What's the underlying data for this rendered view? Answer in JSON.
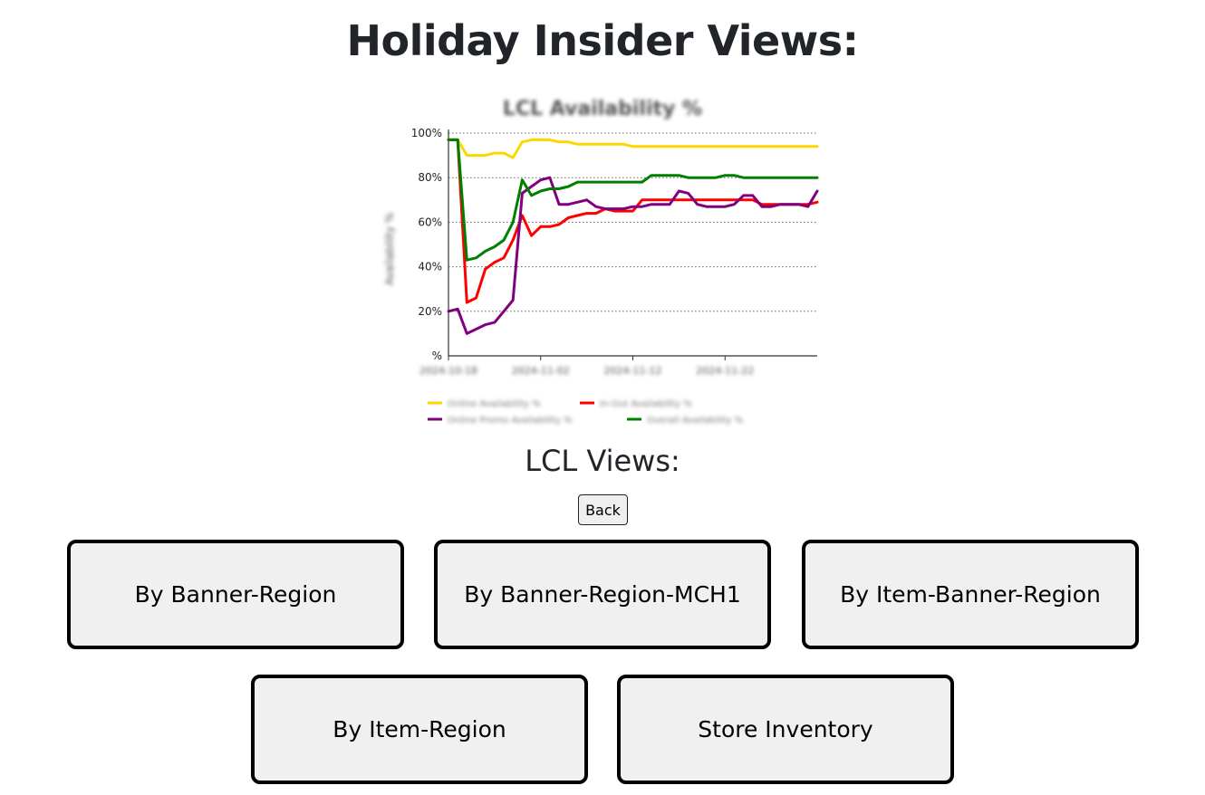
{
  "page": {
    "title": "Holiday Insider Views:",
    "section_title": "LCL Views:",
    "back_label": "Back"
  },
  "views": [
    {
      "label": "By Banner-Region"
    },
    {
      "label": "By Banner-Region-MCH1"
    },
    {
      "label": "By Item-Banner-Region"
    },
    {
      "label": "By Item-Region"
    },
    {
      "label": "Store Inventory"
    }
  ],
  "chart_data": {
    "type": "line",
    "title": "LCL Availability %",
    "ylabel": "Availability %",
    "ytick_labels": [
      "%",
      "20%",
      "40%",
      "60%",
      "80%",
      "100%"
    ],
    "ylim": [
      0,
      100
    ],
    "xtick_labels": [
      "2024-10-18",
      "2024-11-02",
      "2024-11-12",
      "2024-11-22"
    ],
    "x_index_range": [
      0,
      40
    ],
    "xtick_indices": [
      0,
      10,
      20,
      30
    ],
    "grid": "horizontal dotted",
    "legend_position": "bottom",
    "series": [
      {
        "name": "Online Availability %",
        "color": "#FFD700",
        "values": [
          97,
          97,
          90,
          90,
          90,
          91,
          91,
          89,
          96,
          97,
          97,
          97,
          96,
          96,
          95,
          95,
          95,
          95,
          95,
          95,
          94,
          94,
          94,
          94,
          94,
          94,
          94,
          94,
          94,
          94,
          94,
          94,
          94,
          94,
          94,
          94,
          94,
          94,
          94,
          94,
          94
        ]
      },
      {
        "name": "In-Out Availability %",
        "color": "#FF0000",
        "values": [
          97,
          97,
          24,
          26,
          39,
          42,
          44,
          52,
          63,
          54,
          58,
          58,
          59,
          62,
          63,
          64,
          64,
          66,
          65,
          65,
          65,
          70,
          70,
          70,
          70,
          70,
          70,
          70,
          70,
          70,
          70,
          70,
          70,
          70,
          68,
          68,
          68,
          68,
          68,
          68,
          69
        ]
      },
      {
        "name": "Online Promo Availability %",
        "color": "#800080",
        "values": [
          20,
          21,
          10,
          12,
          14,
          15,
          20,
          25,
          73,
          76,
          79,
          80,
          68,
          68,
          69,
          70,
          67,
          66,
          66,
          66,
          67,
          67,
          68,
          68,
          68,
          74,
          73,
          68,
          67,
          67,
          67,
          68,
          72,
          72,
          67,
          67,
          68,
          68,
          68,
          67,
          74
        ]
      },
      {
        "name": "Overall Availability %",
        "color": "#008000",
        "values": [
          97,
          97,
          43,
          44,
          47,
          49,
          52,
          60,
          79,
          72,
          74,
          75,
          75,
          76,
          78,
          78,
          78,
          78,
          78,
          78,
          78,
          78,
          81,
          81,
          81,
          81,
          80,
          80,
          80,
          80,
          81,
          81,
          80,
          80,
          80,
          80,
          80,
          80,
          80,
          80,
          80
        ]
      }
    ]
  }
}
